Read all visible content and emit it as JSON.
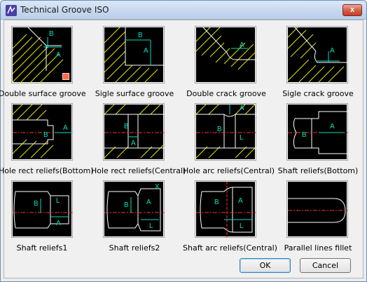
{
  "window": {
    "title": "Technical Groove ISO",
    "close_label": "x"
  },
  "tiles": [
    {
      "caption": "Double surface groove",
      "selected": true
    },
    {
      "caption": "Sigle surface groove"
    },
    {
      "caption": "Double crack groove"
    },
    {
      "caption": "Sigle crack groove"
    },
    {
      "caption": "Hole rect reliefs(Bottom)"
    },
    {
      "caption": "Hole rect reliefs(Central)"
    },
    {
      "caption": "Hole arc reliefs(Central)"
    },
    {
      "caption": "Shaft reliefs(Bottom)"
    },
    {
      "caption": "Shaft reliefs1"
    },
    {
      "caption": "Shaft reliefs2"
    },
    {
      "caption": "Shaft arc reliefs(Central)"
    },
    {
      "caption": "Parallel lines fillet"
    }
  ],
  "dim_labels": {
    "a": "A",
    "b": "B",
    "l": "L",
    "x": "X"
  },
  "buttons": {
    "ok": "OK",
    "cancel": "Cancel"
  },
  "colors": {
    "hatch": "#e6e600",
    "line": "#ffffff",
    "dim": "#00e0c0",
    "center": "#ff3030"
  }
}
